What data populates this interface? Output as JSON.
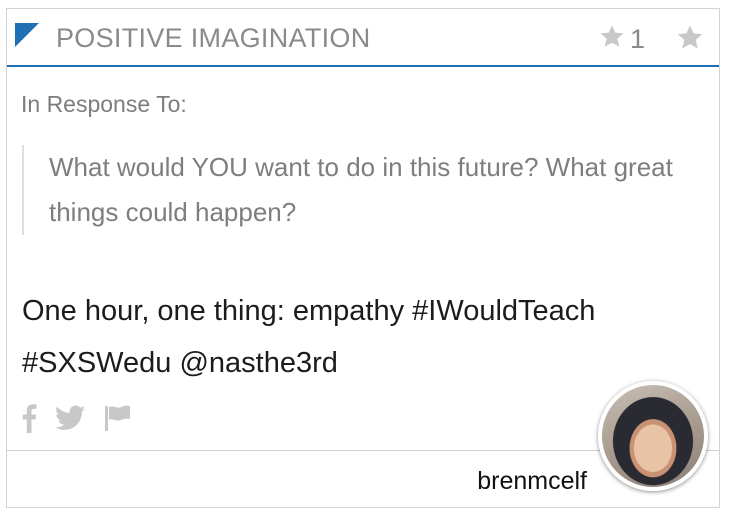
{
  "header": {
    "title": "POSITIVE IMAGINATION",
    "star_count": "1"
  },
  "prompt": {
    "label": "In Response To:",
    "question": "What would YOU want to do in this future? What great things could happen?"
  },
  "response": {
    "text": "One hour, one thing: empathy #IWouldTeach #SXSWedu @nasthe3rd"
  },
  "social": [
    "facebook-icon",
    "twitter-icon",
    "flag-icon"
  ],
  "author": {
    "username": "brenmcelf"
  },
  "colors": {
    "accent": "#1f6fb5",
    "muted_text": "#8a8a8a",
    "body_text": "#1c1c1c",
    "icon_gray": "#c8c8c8"
  }
}
